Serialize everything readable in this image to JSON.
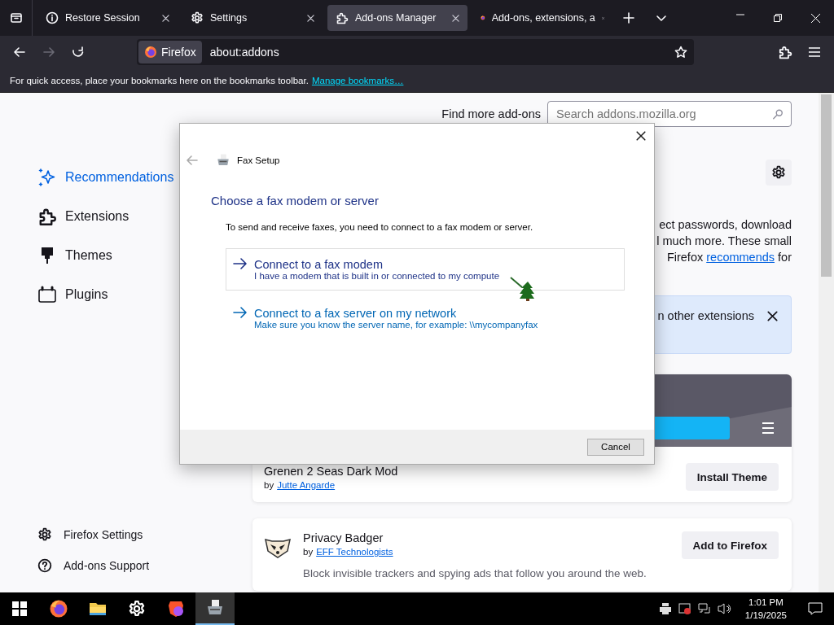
{
  "tabs": [
    {
      "label": "Restore Session",
      "kind": "info",
      "selected": false
    },
    {
      "label": "Settings",
      "kind": "gear",
      "selected": false
    },
    {
      "label": "Add-ons Manager",
      "kind": "puzzle",
      "selected": true
    },
    {
      "label": "Add-ons, extensions, a",
      "kind": "firefox",
      "selected": false
    }
  ],
  "url_bar": {
    "identity": "Firefox",
    "url": "about:addons"
  },
  "bookmarks_bar": {
    "message": "For quick access, place your bookmarks here on the bookmarks toolbar.",
    "link": "Manage bookmarks…"
  },
  "sidebar": {
    "items": [
      {
        "label": "Recommendations",
        "kind": "sparkle",
        "selected": true
      },
      {
        "label": "Extensions",
        "kind": "puzzle",
        "selected": false
      },
      {
        "label": "Themes",
        "kind": "brush",
        "selected": false
      },
      {
        "label": "Plugins",
        "kind": "plugin",
        "selected": false
      }
    ],
    "footer": [
      {
        "label": "Firefox Settings",
        "kind": "gear"
      },
      {
        "label": "Add-ons Support",
        "kind": "help"
      }
    ]
  },
  "header": {
    "find_label": "Find more add-ons",
    "search_placeholder": "Search addons.mozilla.org"
  },
  "intro": {
    "lines": [
      "ect passwords, download",
      "l much more. These small"
    ],
    "last_before": "Firefox",
    "last_link": "recommends",
    "last_after": "for"
  },
  "banner": {
    "text": "n other extensions"
  },
  "theme_card": {
    "name": "Grenen 2 Seas Dark Mod",
    "by": "by",
    "author": "Jutte Angarde",
    "button": "Install Theme"
  },
  "extension_card": {
    "name": "Privacy Badger",
    "by": "by",
    "author": "EFF Technologists",
    "button": "Add to Firefox",
    "description": "Block invisible trackers and spying ads that follow you around the web."
  },
  "dialog": {
    "title": "Fax Setup",
    "heading": "Choose a fax modem or server",
    "description": "To send and receive faxes, you need to connect to a fax modem or server.",
    "options": [
      {
        "title": "Connect to a fax modem",
        "subtitle": "I have a modem that is built in or connected to my compute",
        "hovered": true
      },
      {
        "title": "Connect to a fax server on my network",
        "subtitle": "Make sure you know the server name, for example: \\\\mycompanyfax",
        "hovered": false
      }
    ],
    "cancel": "Cancel"
  },
  "taskbar": {
    "apps": [
      {
        "kind": "firefox",
        "selected": false
      },
      {
        "kind": "folder",
        "selected": false
      },
      {
        "kind": "gear",
        "selected": false
      },
      {
        "kind": "brave",
        "selected": false
      },
      {
        "kind": "fax",
        "selected": true
      }
    ],
    "time": "1:01 PM",
    "date": "1/19/2025"
  }
}
